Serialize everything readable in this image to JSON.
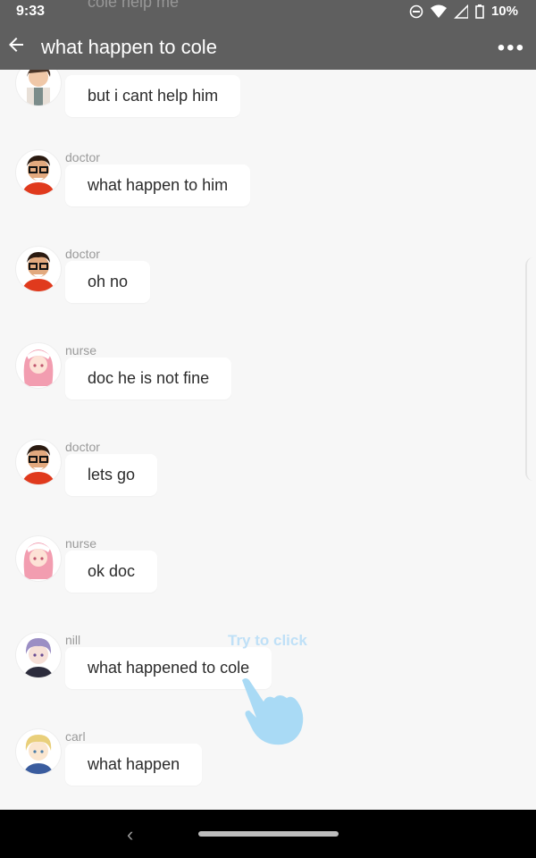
{
  "status_bar": {
    "time": "9:33",
    "battery": "10%"
  },
  "header": {
    "title": "what happen to cole",
    "ghost_text": "cole help me"
  },
  "hint": {
    "text": "Try to click"
  },
  "messages": [
    {
      "sender": "",
      "text": "but i cant help him"
    },
    {
      "sender": "doctor",
      "text": "what happen to him"
    },
    {
      "sender": "doctor",
      "text": "oh no"
    },
    {
      "sender": "nurse",
      "text": "doc he is not fine"
    },
    {
      "sender": "doctor",
      "text": "lets go"
    },
    {
      "sender": "nurse",
      "text": "ok doc"
    },
    {
      "sender": "nill",
      "text": "what happened to cole"
    },
    {
      "sender": "carl",
      "text": "what happen"
    }
  ]
}
